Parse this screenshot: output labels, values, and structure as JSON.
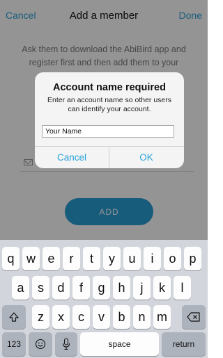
{
  "nav": {
    "cancel": "Cancel",
    "title": "Add a member",
    "done": "Done"
  },
  "intro": "Ask them to download the AbiBird app and register first and then add them to your",
  "add_button": "ADD",
  "alert": {
    "title": "Account name required",
    "message": "Enter an account name so other users can identify your account.",
    "input_value": "Your Name",
    "cancel": "Cancel",
    "ok": "OK"
  },
  "keyboard": {
    "row1": [
      "q",
      "w",
      "e",
      "r",
      "t",
      "y",
      "u",
      "i",
      "o",
      "p"
    ],
    "row2": [
      "a",
      "s",
      "d",
      "f",
      "g",
      "h",
      "j",
      "k",
      "l"
    ],
    "row3": [
      "z",
      "x",
      "c",
      "v",
      "b",
      "n",
      "m"
    ],
    "numbers_key": "123",
    "space_key": "space",
    "return_key": "return",
    "icons": {
      "shift": "shift-icon",
      "delete": "backspace-icon",
      "emoji": "emoji-icon",
      "mic": "microphone-icon"
    }
  }
}
